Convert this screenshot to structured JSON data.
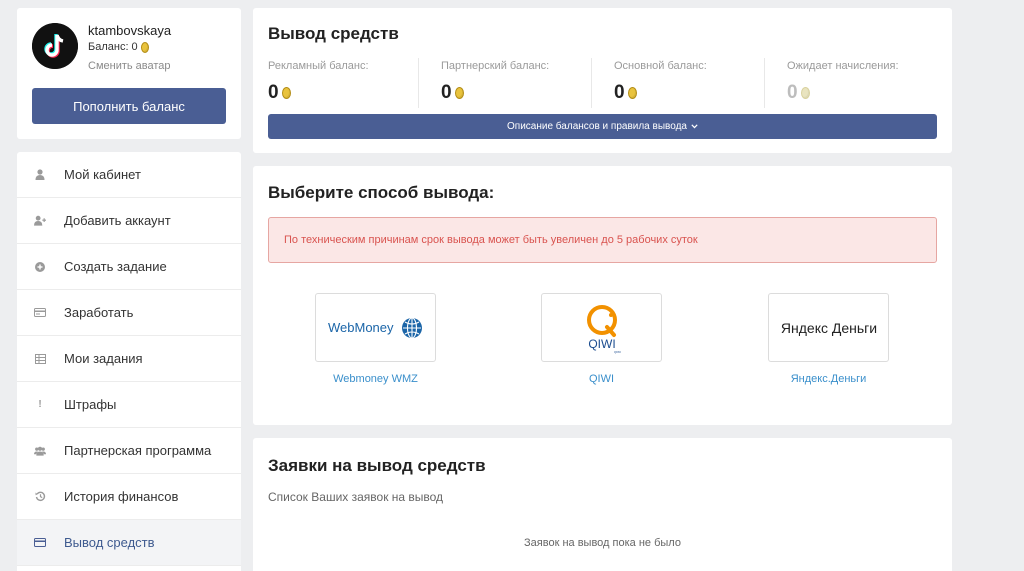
{
  "profile": {
    "username": "ktambovskaya",
    "balance_label": "Баланс: 0",
    "change_avatar": "Сменить аватар",
    "topup_button": "Пополнить баланс"
  },
  "menu": {
    "items": [
      {
        "label": "Мой кабинет",
        "icon": "user-icon"
      },
      {
        "label": "Добавить аккаунт",
        "icon": "user-plus-icon"
      },
      {
        "label": "Создать задание",
        "icon": "plus-circle-icon"
      },
      {
        "label": "Заработать",
        "icon": "card-icon"
      },
      {
        "label": "Мои задания",
        "icon": "grid-icon"
      },
      {
        "label": "Штрафы",
        "icon": "exclamation-icon"
      },
      {
        "label": "Партнерская программа",
        "icon": "users-icon"
      },
      {
        "label": "История финансов",
        "icon": "history-icon"
      },
      {
        "label": "Вывод средств",
        "icon": "credit-card-icon"
      }
    ],
    "active_index": 8
  },
  "balances": {
    "title": "Вывод средств",
    "items": [
      {
        "label": "Рекламный баланс:",
        "value": "0"
      },
      {
        "label": "Партнерский баланс:",
        "value": "0"
      },
      {
        "label": "Основной баланс:",
        "value": "0"
      },
      {
        "label": "Ожидает начисления:",
        "value": "0"
      }
    ],
    "rules_button": "Описание балансов и правила вывода"
  },
  "methods": {
    "title": "Выберите способ вывода:",
    "alert": "По техническим причинам срок вывода может быть увеличен до 5 рабочих суток",
    "items": [
      {
        "label": "Webmoney WMZ",
        "logo_text": "WebMoney",
        "icon": "webmoney-logo-icon"
      },
      {
        "label": "QIWI",
        "logo_text": "QIWI",
        "logo_subtext": "QIWI",
        "icon": "qiwi-logo-icon"
      },
      {
        "label": "Яндекс.Деньги",
        "logo_text": "Яндекс Деньги",
        "icon": "yandex-money-logo-icon"
      }
    ]
  },
  "requests": {
    "title": "Заявки на вывод средств",
    "subtitle": "Список Ваших заявок на вывод",
    "empty": "Заявок на вывод пока не было"
  },
  "colors": {
    "accent": "#4a5e94",
    "link": "#3a8fcb",
    "alert_text": "#d9534f",
    "alert_bg": "#fbe7e6",
    "background": "#edeef0"
  }
}
